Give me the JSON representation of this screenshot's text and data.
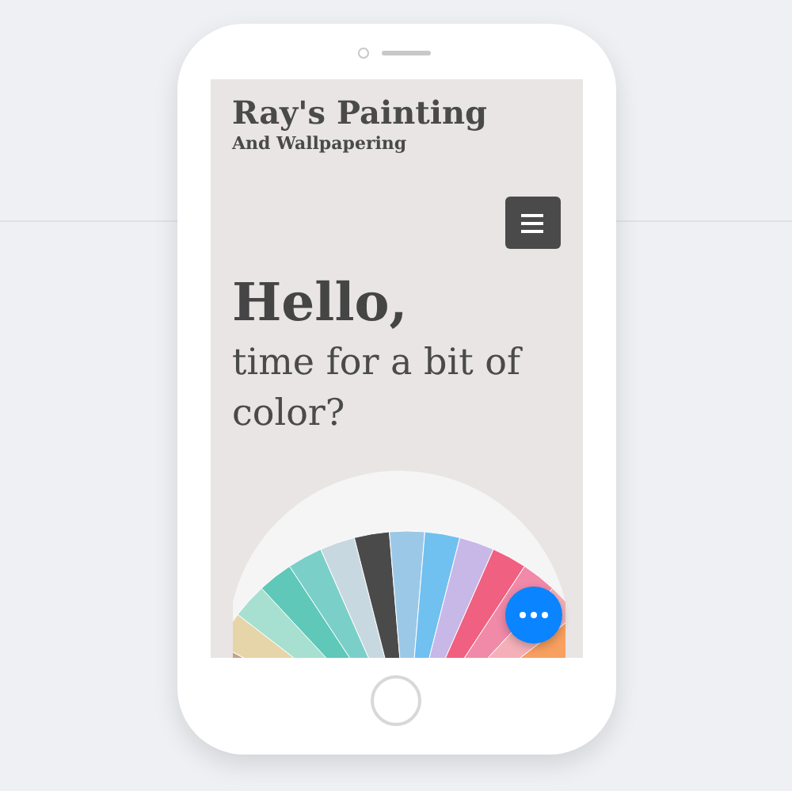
{
  "site": {
    "title": "Ray's Painting",
    "subtitle": "And Wallpapering"
  },
  "hero": {
    "heading": "Hello,",
    "text": "time for a bit of color?"
  }
}
